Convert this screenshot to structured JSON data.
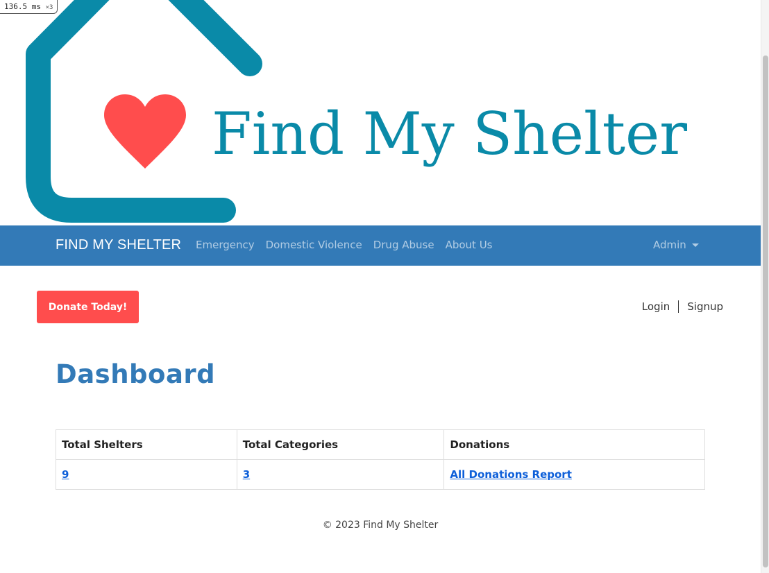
{
  "perf": {
    "time": "136.5",
    "unit": "ms",
    "multiplier": "×3"
  },
  "logo": {
    "text": "Find My Shelter",
    "icons": [
      "house-outline-icon",
      "heart-icon"
    ],
    "colors": {
      "house": "#0a8aa8",
      "heart": "#ff4d4d",
      "text": "#0a8aa8"
    }
  },
  "navbar": {
    "brand": "FIND MY SHELTER",
    "links": [
      "Emergency",
      "Domestic Violence",
      "Drug Abuse",
      "About Us"
    ],
    "admin": "Admin",
    "bg_color": "#337ab7"
  },
  "donate": {
    "label": "Donate Today!",
    "color": "#ff4d4d"
  },
  "auth": {
    "login": "Login",
    "signup": "Signup"
  },
  "page": {
    "title": "Dashboard"
  },
  "table": {
    "headers": [
      "Total Shelters",
      "Total Categories",
      "Donations"
    ],
    "row": [
      "9",
      "3",
      "All Donations Report"
    ]
  },
  "footer": {
    "text": "© 2023 Find My Shelter"
  }
}
